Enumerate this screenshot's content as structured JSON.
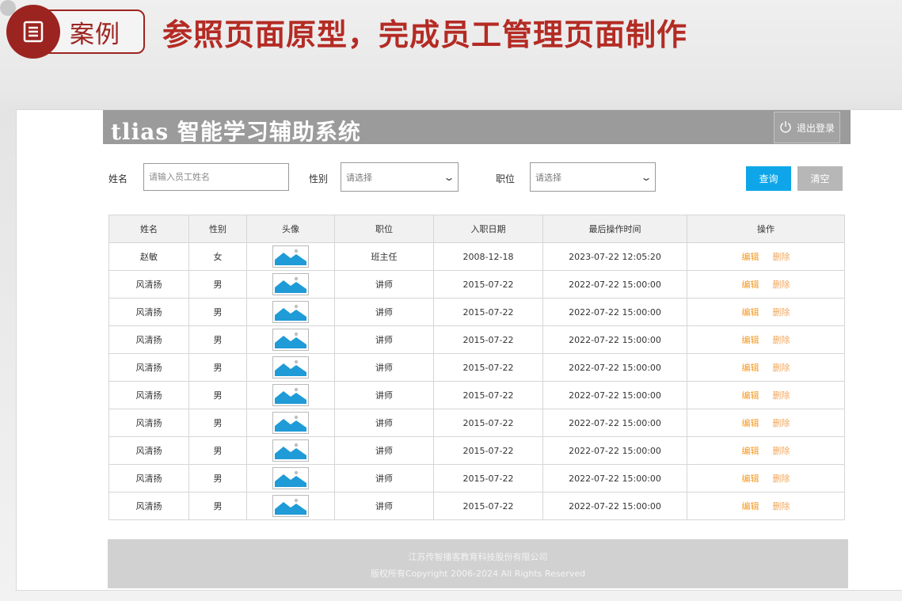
{
  "slide": {
    "tag": "案例",
    "title": "参照页面原型，完成员工管理页面制作",
    "accent_color": "#9c2420",
    "tag_icon": "document-list-icon"
  },
  "app": {
    "logo": "tlias 智能学习辅助系统",
    "logout_label": "退出登录",
    "logout_icon": "power-icon"
  },
  "search": {
    "name_label": "姓名",
    "name_placeholder": "请输入员工姓名",
    "gender_label": "性别",
    "gender_value": "请选择",
    "job_label": "职位",
    "job_value": "请选择",
    "query_label": "查询",
    "clear_label": "清空",
    "query_color": "#0ea6e9"
  },
  "table": {
    "headers": [
      "姓名",
      "性别",
      "头像",
      "职位",
      "入职日期",
      "最后操作时间",
      "操作"
    ],
    "edit_label": "编辑",
    "delete_label": "删除",
    "avatar_icon": "image-placeholder-icon",
    "rows": [
      {
        "name": "赵敏",
        "gender": "女",
        "job": "班主任",
        "entry_date": "2008-12-18",
        "update_time": "2023-07-22 12:05:20"
      },
      {
        "name": "风清扬",
        "gender": "男",
        "job": "讲师",
        "entry_date": "2015-07-22",
        "update_time": "2022-07-22 15:00:00"
      },
      {
        "name": "风清扬",
        "gender": "男",
        "job": "讲师",
        "entry_date": "2015-07-22",
        "update_time": "2022-07-22 15:00:00"
      },
      {
        "name": "风清扬",
        "gender": "男",
        "job": "讲师",
        "entry_date": "2015-07-22",
        "update_time": "2022-07-22 15:00:00"
      },
      {
        "name": "风清扬",
        "gender": "男",
        "job": "讲师",
        "entry_date": "2015-07-22",
        "update_time": "2022-07-22 15:00:00"
      },
      {
        "name": "风清扬",
        "gender": "男",
        "job": "讲师",
        "entry_date": "2015-07-22",
        "update_time": "2022-07-22 15:00:00"
      },
      {
        "name": "风清扬",
        "gender": "男",
        "job": "讲师",
        "entry_date": "2015-07-22",
        "update_time": "2022-07-22 15:00:00"
      },
      {
        "name": "风清扬",
        "gender": "男",
        "job": "讲师",
        "entry_date": "2015-07-22",
        "update_time": "2022-07-22 15:00:00"
      },
      {
        "name": "风清扬",
        "gender": "男",
        "job": "讲师",
        "entry_date": "2015-07-22",
        "update_time": "2022-07-22 15:00:00"
      },
      {
        "name": "风清扬",
        "gender": "男",
        "job": "讲师",
        "entry_date": "2015-07-22",
        "update_time": "2022-07-22 15:00:00"
      }
    ]
  },
  "footer": {
    "company": "江苏传智播客教育科技股份有限公司",
    "copyright": "版权所有Copyright 2006-2024  All Rights Reserved"
  }
}
